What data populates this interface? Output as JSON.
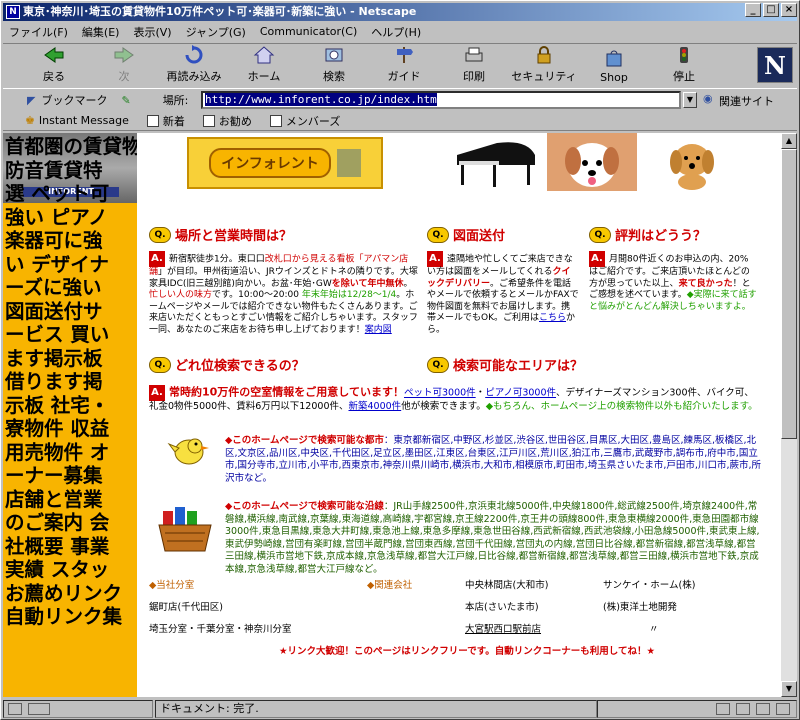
{
  "window": {
    "title": "東京･神奈川･埼玉の賃貸物件10万件ペット可･楽器可･新築に強い - Netscape"
  },
  "menu": [
    "ファイル(F)",
    "編集(E)",
    "表示(V)",
    "ジャンプ(G)",
    "Communicator(C)",
    "ヘルプ(H)"
  ],
  "toolbar": [
    "戻る",
    "次",
    "再読み込み",
    "ホーム",
    "検索",
    "ガイド",
    "印刷",
    "セキュリティ",
    "Shop",
    "停止"
  ],
  "location": {
    "bookmark_label": "ブックマーク",
    "label": "場所:",
    "url": "http://www.inforent.co.jp/index.htm",
    "related": "関連サイト"
  },
  "personal": [
    "Instant Message",
    "新着",
    "お勧め",
    "メンバーズ"
  ],
  "status": {
    "message": "ドキュメント: 完了."
  },
  "left_menu": [
    "首都圏の賃貸物件",
    " 防音賃貸特",
    "選 ペット可",
    "強い ピアノ",
    "楽器可に強",
    "い デザイナ",
    "ーズに強い",
    " 図面送付サ",
    "ービス 買い",
    "ます掲示板",
    " 借ります掲",
    "示板 社宅・",
    "寮物件 収益",
    "用売物件 オ",
    "ーナー募集",
    " 店舗と営業",
    "のご案内 会",
    "社概要 事業",
    "実績 スタッ",
    "お薦めリンク",
    " 自動リンク集"
  ],
  "logo_text": "インフォレント",
  "left_logo_text": "INFORENT",
  "q1": {
    "title": "場所と営業時間は？",
    "body_a": "新宿駅徒歩1分。東口口",
    "body_b": "改札口から見える看板「アパマン店舗",
    "body_c": "」が目印。甲州街道沿い、JRウインズとドトネの隣りです。大塚家具IDC(旧三越別館)向かい。お盆･年始･GW",
    "body_d": "を除いて年中無休",
    "body_e": "。",
    "body_f": "忙しい人の味方",
    "body_g": "です。10:00〜20:00",
    "body_h": " 年末年始は12/28〜1/4",
    "body_i": "。ホームページやメールでは紹介できない物件もたくさんあります。ご来店いただくともっとすごい情報をご紹介しちゃいます。スタッフ一同、あなたのご来店をお待ち申し上げております！",
    "link": "案内図"
  },
  "q2": {
    "title": "図面送付",
    "body_a": "遠隔地や忙しくてご来店できない方は図面をメールしてくれる",
    "body_b": "クイックデリバリー",
    "body_c": "。ご希望条件を電話やメールで依頼するとメールかFAXで物件図面を無料でお届けします。携帯メールでもOK。ご利用は",
    "link": "こちら",
    "body_d": "から。"
  },
  "q3": {
    "title": "評判はどうう？",
    "body_a": "月間80件近くのお申込の内、20%はご紹介です。ご来店頂いたほとんどの方が思っていた以上、",
    "body_b": "来て良かった",
    "body_c": "！とご感想を述べています。",
    "body_d": "◆実際に来て話すと悩みがとんどん解決しちゃいますよ。"
  },
  "q4": {
    "title": "どれ位検索できるの？"
  },
  "q5": {
    "title": "検索可能なエリアは？"
  },
  "banner": {
    "title": "常時約10万件の空室情報をご用意しています！",
    "link1": "ペット可3000件",
    "sep1": "・",
    "link2": "ピアノ可3000件",
    "text1": "、デザイナーズマンション300件、バイク可、礼金0物件5000件、賃料6万円以下12000件、",
    "link3": "新築4000件",
    "text2": "他が検索できます。",
    "text3": "◆もちろん、ホームページ上の検索物件以外も紹介いたします。"
  },
  "cities": {
    "title": "◆このホームページで検索可能な都市",
    "body": "：東京都新宿区,中野区,杉並区,渋谷区,世田谷区,目黒区,大田区,豊島区,練馬区,板橋区,北区,文京区,品川区,中央区,千代田区,足立区,墨田区,江東区,台東区,江戸川区,荒川区,狛江市,三鷹市,武蔵野市,調布市,府中市,国立市,国分寺市,立川市,小平市,西東京市,神奈川県川崎市,横浜市,大和市,相模原市,町田市,埼玉県さいたま市,戸田市,川口市,蕨市,所沢市など。"
  },
  "lines": {
    "title": "◆このホームページで検索可能な沿線",
    "body": "：JR山手線2500件,京浜東北線5000件,中央線1800件,総武線2500件,埼京線2400件,常磐線,横浜線,南武線,京葉線,東海道線,高崎線,宇都宮線,京王線2200件,京王井の頭線800件,東急東横線2000件,東急田園都市線3000件,東急目黒線,東急大井町線,東急池上線,東急多摩線,東急世田谷線,西武新宿線,西武池袋線,小田急線5000件,東武東上線,東武伊勢崎線,営団有楽町線,営団半蔵門線,営団東西線,営団千代田線,営団丸の内線,営団日比谷線,都営新宿線,都営浅草線,都営三田線,横浜市営地下鉄,京成本線,京急浅草線,都営大江戸線,日比谷線,都営新宿線,都営浅草線,都営三田線,横浜市営地下鉄,京成本線,京急浅草線,都営大江戸線など。"
  },
  "offices": {
    "h1": "◆当社分室",
    "h2": "◆関連会社",
    "c3r1": "中央林間店(大和市)",
    "c4r1": "サンケイ・ホーム(株)",
    "c1r2": "鋸町店(千代田区)",
    "c3r2": "本店(さいたま市)",
    "c4r2": "(株)東洋土地開発",
    "c1r3": "埼玉分室・千葉分室・神奈川分室",
    "c3r3": "大宮駅西口駅前店",
    "c4r3": "〃"
  },
  "footer": "★リンク大歓迎！このページはリンクフリーです。自動リンクコーナーも利用してね！★"
}
